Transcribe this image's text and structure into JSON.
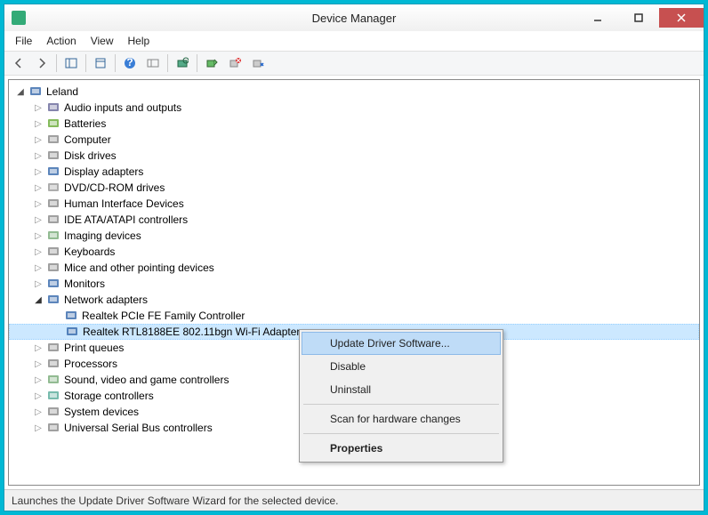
{
  "window": {
    "title": "Device Manager"
  },
  "menubar": [
    "File",
    "Action",
    "View",
    "Help"
  ],
  "tree": {
    "root": "Leland",
    "categories": [
      {
        "label": "Audio inputs and outputs",
        "icon": "audio"
      },
      {
        "label": "Batteries",
        "icon": "battery"
      },
      {
        "label": "Computer",
        "icon": "computer"
      },
      {
        "label": "Disk drives",
        "icon": "disk"
      },
      {
        "label": "Display adapters",
        "icon": "display"
      },
      {
        "label": "DVD/CD-ROM drives",
        "icon": "dvd"
      },
      {
        "label": "Human Interface Devices",
        "icon": "hid"
      },
      {
        "label": "IDE ATA/ATAPI controllers",
        "icon": "ide"
      },
      {
        "label": "Imaging devices",
        "icon": "imaging"
      },
      {
        "label": "Keyboards",
        "icon": "keyboard"
      },
      {
        "label": "Mice and other pointing devices",
        "icon": "mouse"
      },
      {
        "label": "Monitors",
        "icon": "monitor"
      },
      {
        "label": "Network adapters",
        "icon": "network",
        "expanded": true,
        "children": [
          {
            "label": "Realtek PCIe FE Family Controller",
            "icon": "nic"
          },
          {
            "label": "Realtek RTL8188EE 802.11bgn Wi-Fi Adapter",
            "icon": "nic",
            "selected": true
          }
        ]
      },
      {
        "label": "Print queues",
        "icon": "print"
      },
      {
        "label": "Processors",
        "icon": "cpu"
      },
      {
        "label": "Sound, video and game controllers",
        "icon": "sound"
      },
      {
        "label": "Storage controllers",
        "icon": "storage"
      },
      {
        "label": "System devices",
        "icon": "system"
      },
      {
        "label": "Universal Serial Bus controllers",
        "icon": "usb"
      }
    ]
  },
  "context_menu": {
    "items": [
      {
        "label": "Update Driver Software...",
        "hover": true
      },
      {
        "label": "Disable"
      },
      {
        "label": "Uninstall"
      },
      {
        "sep": true
      },
      {
        "label": "Scan for hardware changes"
      },
      {
        "sep": true
      },
      {
        "label": "Properties",
        "bold": true
      }
    ]
  },
  "statusbar": "Launches the Update Driver Software Wizard for the selected device."
}
